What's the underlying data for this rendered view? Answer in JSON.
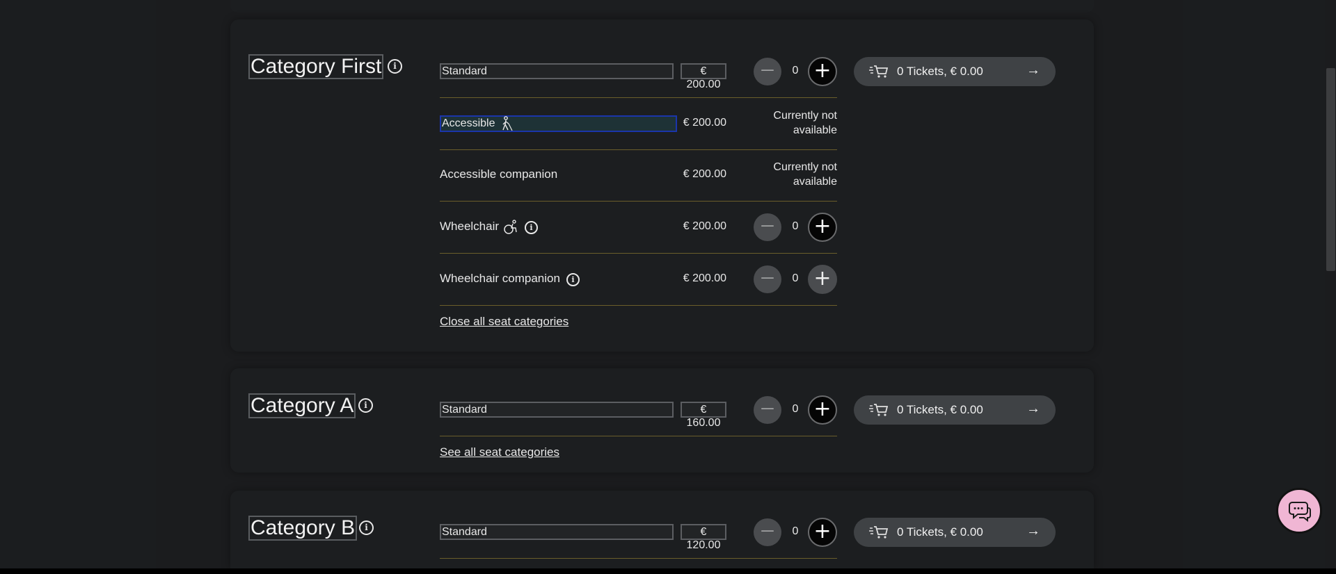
{
  "categories": [
    {
      "title": "Category First",
      "standard_label": "Standard",
      "standard_price": "€ 200.00",
      "quantity": "0",
      "cart_label": "0 Tickets, € 0.00",
      "rows": [
        {
          "label": "Accessible",
          "price": "€ 200.00",
          "status": "Currently not available"
        },
        {
          "label": "Accessible companion",
          "price": "€ 200.00",
          "status": "Currently not available"
        },
        {
          "label": "Wheelchair",
          "price": "€ 200.00",
          "quantity": "0"
        },
        {
          "label": "Wheelchair companion",
          "price": "€ 200.00",
          "quantity": "0"
        }
      ],
      "link": "Close all seat categories"
    },
    {
      "title": "Category A",
      "standard_label": "Standard",
      "standard_price": "€ 160.00",
      "quantity": "0",
      "cart_label": "0 Tickets, € 0.00",
      "link": "See all seat categories"
    },
    {
      "title": "Category B",
      "standard_label": "Standard",
      "standard_price": "€ 120.00",
      "quantity": "0",
      "cart_label": "0 Tickets, € 0.00"
    }
  ],
  "icons": {
    "info": "info-icon",
    "accessible": "blind-person-icon",
    "wheelchair": "wheelchair-icon",
    "cart": "shopping-cart-icon",
    "arrow": "arrow-right-icon",
    "chat": "chat-icon"
  },
  "colors": {
    "background": "#1b1d1f",
    "divider": "#6b5e2b",
    "chat_button": "#f0b6d4",
    "focus_border": "#1a35ab"
  }
}
